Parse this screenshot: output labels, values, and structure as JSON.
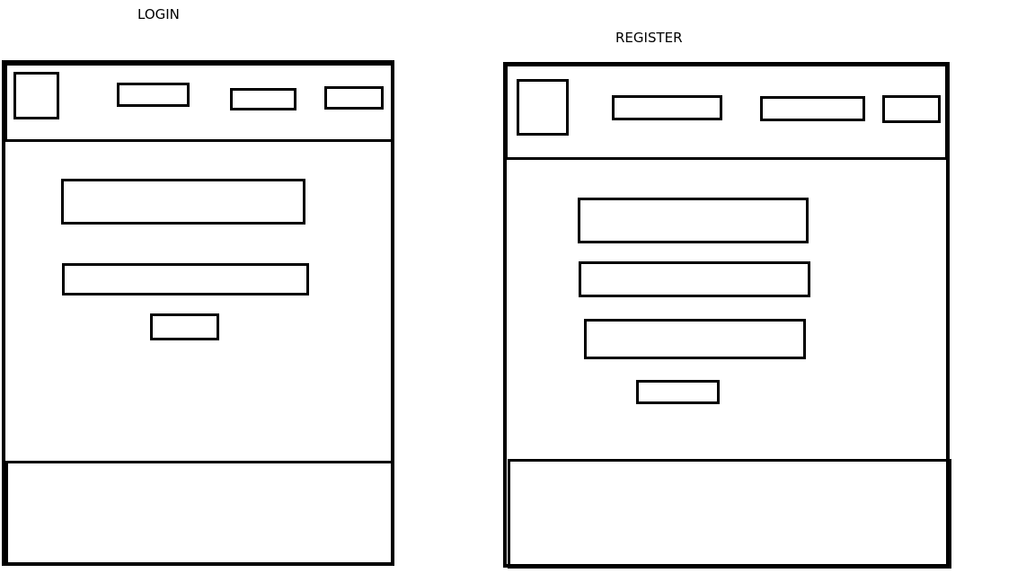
{
  "wireframes": [
    {
      "title": "LOGIN"
    },
    {
      "title": "REGISTER"
    }
  ]
}
